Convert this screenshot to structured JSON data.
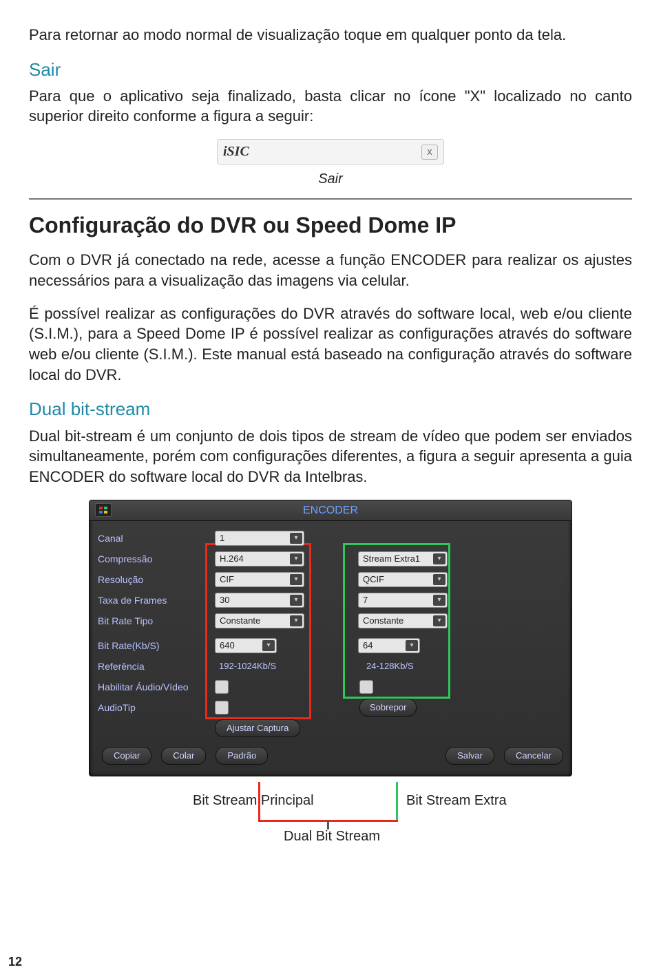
{
  "intro_paragraph": "Para retornar ao modo normal de visualização toque em qualquer ponto da tela.",
  "sair": {
    "heading": "Sair",
    "paragraph": "Para que o aplicativo seja finalizado, basta clicar no ícone \"X\" localizado no canto superior direito conforme a figura a seguir:",
    "bar_label": "iSIC",
    "close_glyph": "x",
    "caption": "Sair"
  },
  "config": {
    "title": "Configuração do DVR ou Speed Dome IP",
    "para1": "Com o DVR já conectado na rede, acesse a função ENCODER para realizar os ajustes necessários para a visualização das imagens via celular.",
    "para2": "É possível realizar as configurações do DVR através do software local, web e/ou cliente (S.I.M.), para a Speed Dome IP é possível realizar as configurações através do software web e/ou cliente (S.I.M.). Este manual está baseado na configuração através do software local do DVR."
  },
  "dual": {
    "heading": "Dual bit-stream",
    "paragraph": "Dual bit-stream é um conjunto de dois tipos de stream de vídeo que podem ser enviados simultaneamente, porém com configurações diferentes, a figura a seguir apresenta a guia ENCODER do software local do DVR da Intelbras."
  },
  "encoder": {
    "title": "ENCODER",
    "labels": {
      "canal": "Canal",
      "compressao": "Compressão",
      "resolucao": "Resolução",
      "taxa_frames": "Taxa de Frames",
      "bitrate_tipo": "Bit Rate Tipo",
      "bitrate_kbs": "Bit Rate(Kb/S)",
      "referencia": "Referência",
      "habilitar_av": "Habilitar Áudio/Vídeo",
      "audiotip": "AudioTip"
    },
    "col1": {
      "canal": "1",
      "compressao": "H.264",
      "resolucao": "CIF",
      "taxa_frames": "30",
      "bitrate_tipo": "Constante",
      "bitrate_kbs": "640",
      "referencia": "192-1024Kb/S"
    },
    "col2": {
      "stream_extra": "Stream Extra1",
      "resolucao": "QCIF",
      "taxa_frames": "7",
      "bitrate_tipo": "Constante",
      "bitrate_kbs": "64",
      "referencia": "24-128Kb/S",
      "sobrepor": "Sobrepor"
    },
    "ajustar_captura": "Ajustar Captura",
    "buttons": {
      "copiar": "Copiar",
      "colar": "Colar",
      "padrao": "Padrão",
      "salvar": "Salvar",
      "cancelar": "Cancelar"
    }
  },
  "legend": {
    "principal": "Bit Stream Principal",
    "extra": "Bit Stream Extra",
    "dual": "Dual Bit Stream"
  },
  "page_number": "12"
}
